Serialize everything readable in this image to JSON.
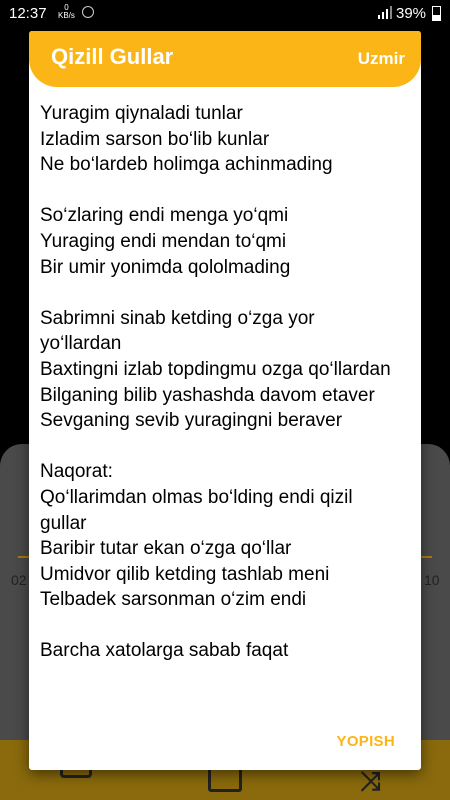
{
  "status_bar": {
    "time": "12:37",
    "speed_value": "0",
    "speed_unit": "KB/s",
    "battery_percent": "39%"
  },
  "background_app": {
    "time_left": "02",
    "time_right": "10"
  },
  "dialog": {
    "title": "Qizill Gullar",
    "artist": "Uzmir",
    "close_label": "YOPISH",
    "accent_color": "#fbb516",
    "stanzas": [
      [
        "Yuragim qiynaladi tunlar",
        "Izladim sarson bo‘lib kunlar",
        "Ne bo‘lardeb holimga achinmading"
      ],
      [
        "So‘zlaring endi menga yo‘qmi",
        "Yuraging endi mendan to‘qmi",
        "Bir umir yonimda qololmading"
      ],
      [
        "Sabrimni sinab ketding o‘zga yor yo‘llardan",
        "Baxtingni izlab topdingmu ozga qo‘llardan",
        "Bilganing bilib yashashda davom etaver",
        "Sevganing sevib yuragingni beraver"
      ],
      [
        "Naqorat:",
        "Qo‘llarimdan olmas bo‘lding endi qizil gullar",
        "Baribir tutar ekan o‘zga qo‘llar",
        "Umidvor qilib ketding tashlab meni",
        "Telbadek sarsonman o‘zim endi"
      ],
      [
        "Barcha xatolarga sabab faqat"
      ]
    ]
  }
}
